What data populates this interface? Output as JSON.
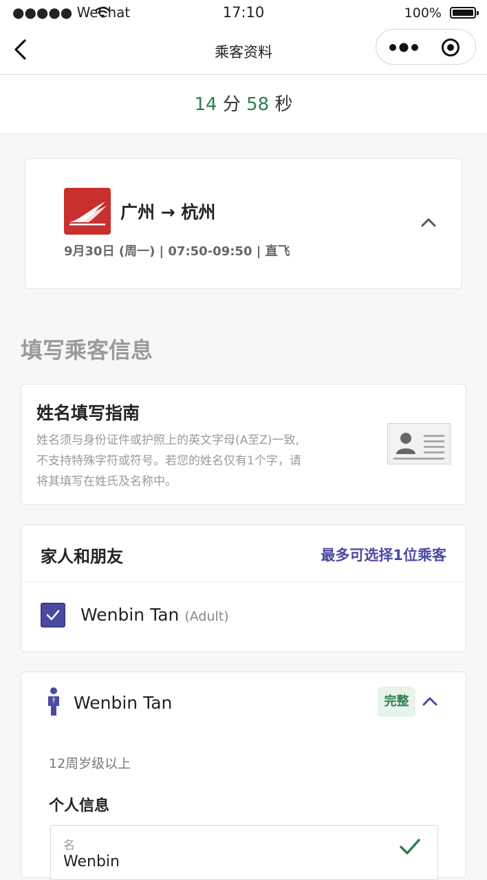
{
  "status_bar": {
    "carrier": "●●●●● WeChat",
    "time": "17:10",
    "battery": "100%"
  },
  "nav": {
    "title": "乘客资料"
  },
  "timer": {
    "minutes": "14",
    "minutes_unit": "分",
    "seconds": "58",
    "seconds_unit": "秒"
  },
  "flight": {
    "route": "广州 → 杭州",
    "meta": "9月30日 (周一) | 07:50-09:50 | 直飞"
  },
  "section_title": "填写乘客信息",
  "guide": {
    "title": "姓名填写指南",
    "lines": [
      "姓名须与身份证件或护照上的英文字母(A至Z)一致,",
      "不支持特殊字符或符号。若您的姓名仅有1个字，请",
      "将其填写在姓氏及名称中。"
    ]
  },
  "family": {
    "title": "家人和朋友",
    "limit": "最多可选择1位乘客",
    "passenger_name": "Wenbin Tan",
    "passenger_type": "(Adult)"
  },
  "passenger": {
    "name": "Wenbin Tan",
    "status": "完整",
    "age_group": "12周岁级以上",
    "section": "个人信息",
    "given_name_label": "名",
    "given_name_value": "Wenbin"
  },
  "colors": {
    "accent": "#4a4aa3",
    "success": "#2e7d4f",
    "airline": "#c92f2c"
  }
}
